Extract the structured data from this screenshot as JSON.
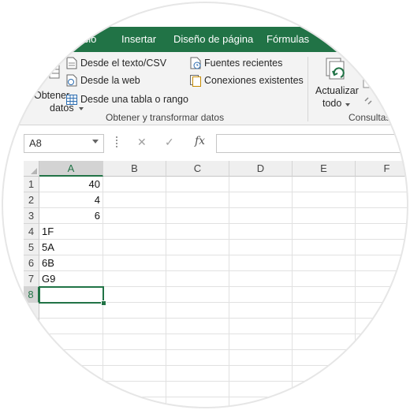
{
  "ribbon": {
    "tabs": [
      {
        "label": "Inicio"
      },
      {
        "label": "Insertar"
      },
      {
        "label": "Diseño de página"
      },
      {
        "label": "Fórmulas"
      }
    ],
    "group_get_transform": {
      "partial_button_line1": "Obtener",
      "partial_button_line2": "datos",
      "from_text_csv": "Desde el texto/CSV",
      "from_web": "Desde la web",
      "from_table_range": "Desde una tabla o rango",
      "recent_sources": "Fuentes recientes",
      "existing_connections": "Conexiones existentes",
      "group_label": "Obtener y transformar datos"
    },
    "group_queries": {
      "refresh_all_line1": "Actualizar",
      "refresh_all_line2": "todo",
      "group_label": "Consultas"
    }
  },
  "formula_bar": {
    "name_box": "A8",
    "cancel_icon": "✕",
    "enter_icon": "✓",
    "fx_icon": "fx",
    "formula": ""
  },
  "sheet": {
    "columns": [
      "A",
      "B",
      "C",
      "D",
      "E",
      "F"
    ],
    "rows": [
      {
        "n": "1",
        "a": "40"
      },
      {
        "n": "2",
        "a": "4"
      },
      {
        "n": "3",
        "a": "6"
      },
      {
        "n": "4",
        "a": "1F"
      },
      {
        "n": "5",
        "a": "5A"
      },
      {
        "n": "6",
        "a": "6B"
      },
      {
        "n": "7",
        "a": "G9"
      },
      {
        "n": "8",
        "a": ""
      }
    ],
    "selected_cell": "A8"
  },
  "colors": {
    "accent": "#217346",
    "ribbon_bg": "#f3f3f3",
    "header_bg": "#efefef"
  }
}
